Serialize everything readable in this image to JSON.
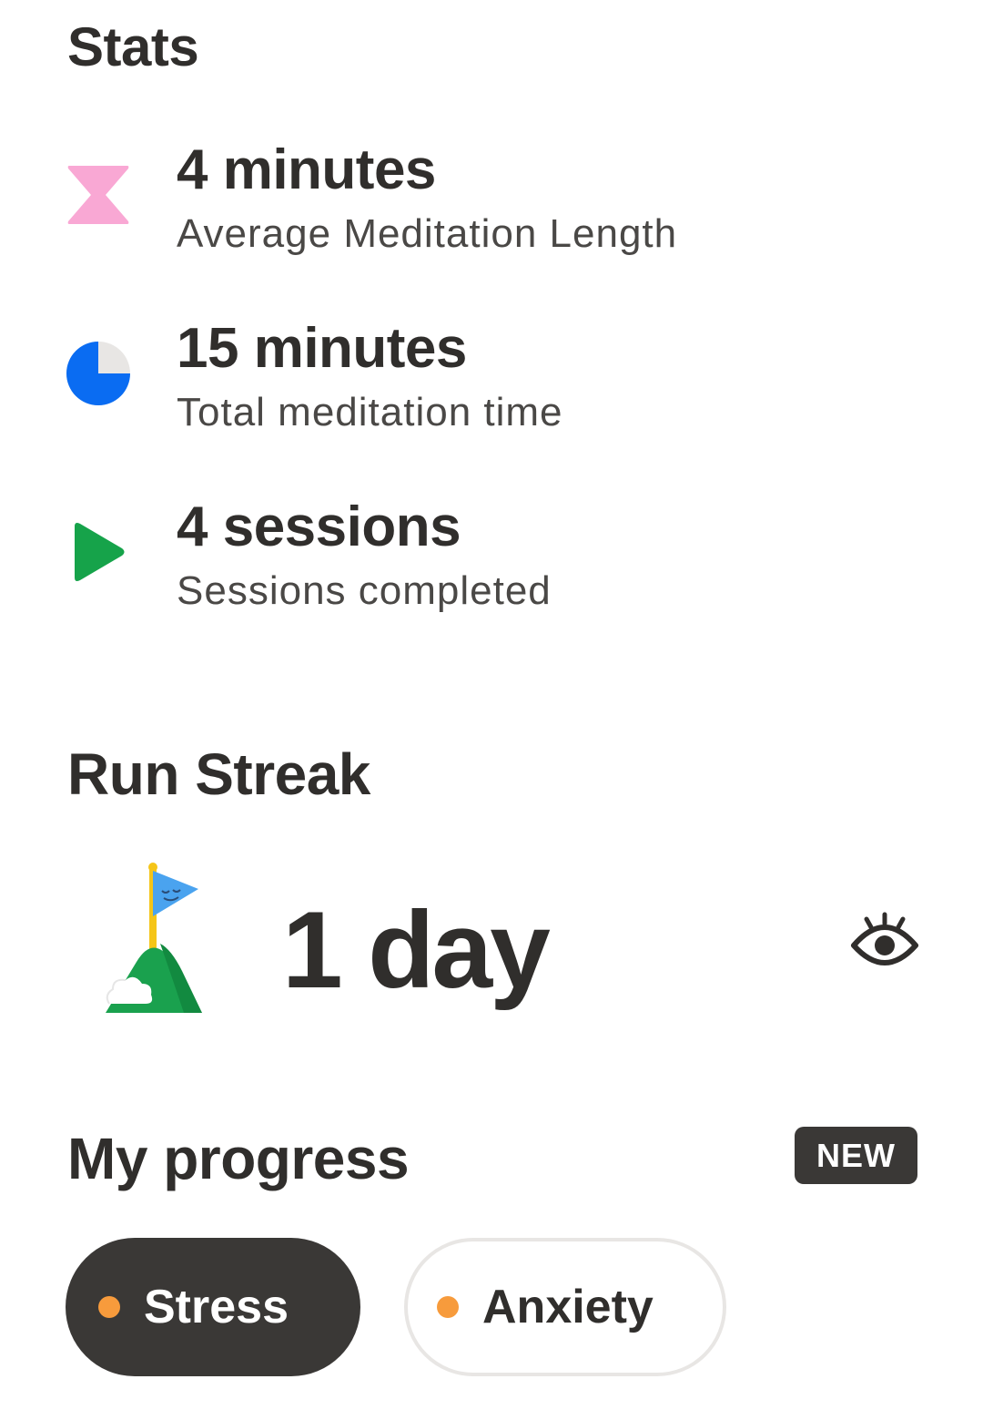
{
  "stats": {
    "title": "Stats",
    "items": [
      {
        "icon": "hourglass-icon",
        "value": "4 minutes",
        "label": "Average Meditation Length",
        "color": "#f9a8d4"
      },
      {
        "icon": "pie-clock-icon",
        "value": "15 minutes",
        "label": "Total meditation time",
        "color": "#0a6cf2"
      },
      {
        "icon": "play-icon",
        "value": "4 sessions",
        "label": "Sessions completed",
        "color": "#16a34a"
      }
    ]
  },
  "streak": {
    "title": "Run Streak",
    "icon": "flag-hill-icon",
    "value": "1 day",
    "toggle_icon": "eye-icon"
  },
  "progress": {
    "title": "My progress",
    "badge": "NEW",
    "chips": [
      {
        "label": "Stress",
        "selected": true,
        "dot_color": "#f79b3c"
      },
      {
        "label": "Anxiety",
        "selected": false,
        "dot_color": "#f79b3c"
      }
    ]
  },
  "colors": {
    "text_primary": "#302e2c",
    "chip_selected_bg": "#3a3836",
    "chip_border": "#e8e6e4"
  }
}
